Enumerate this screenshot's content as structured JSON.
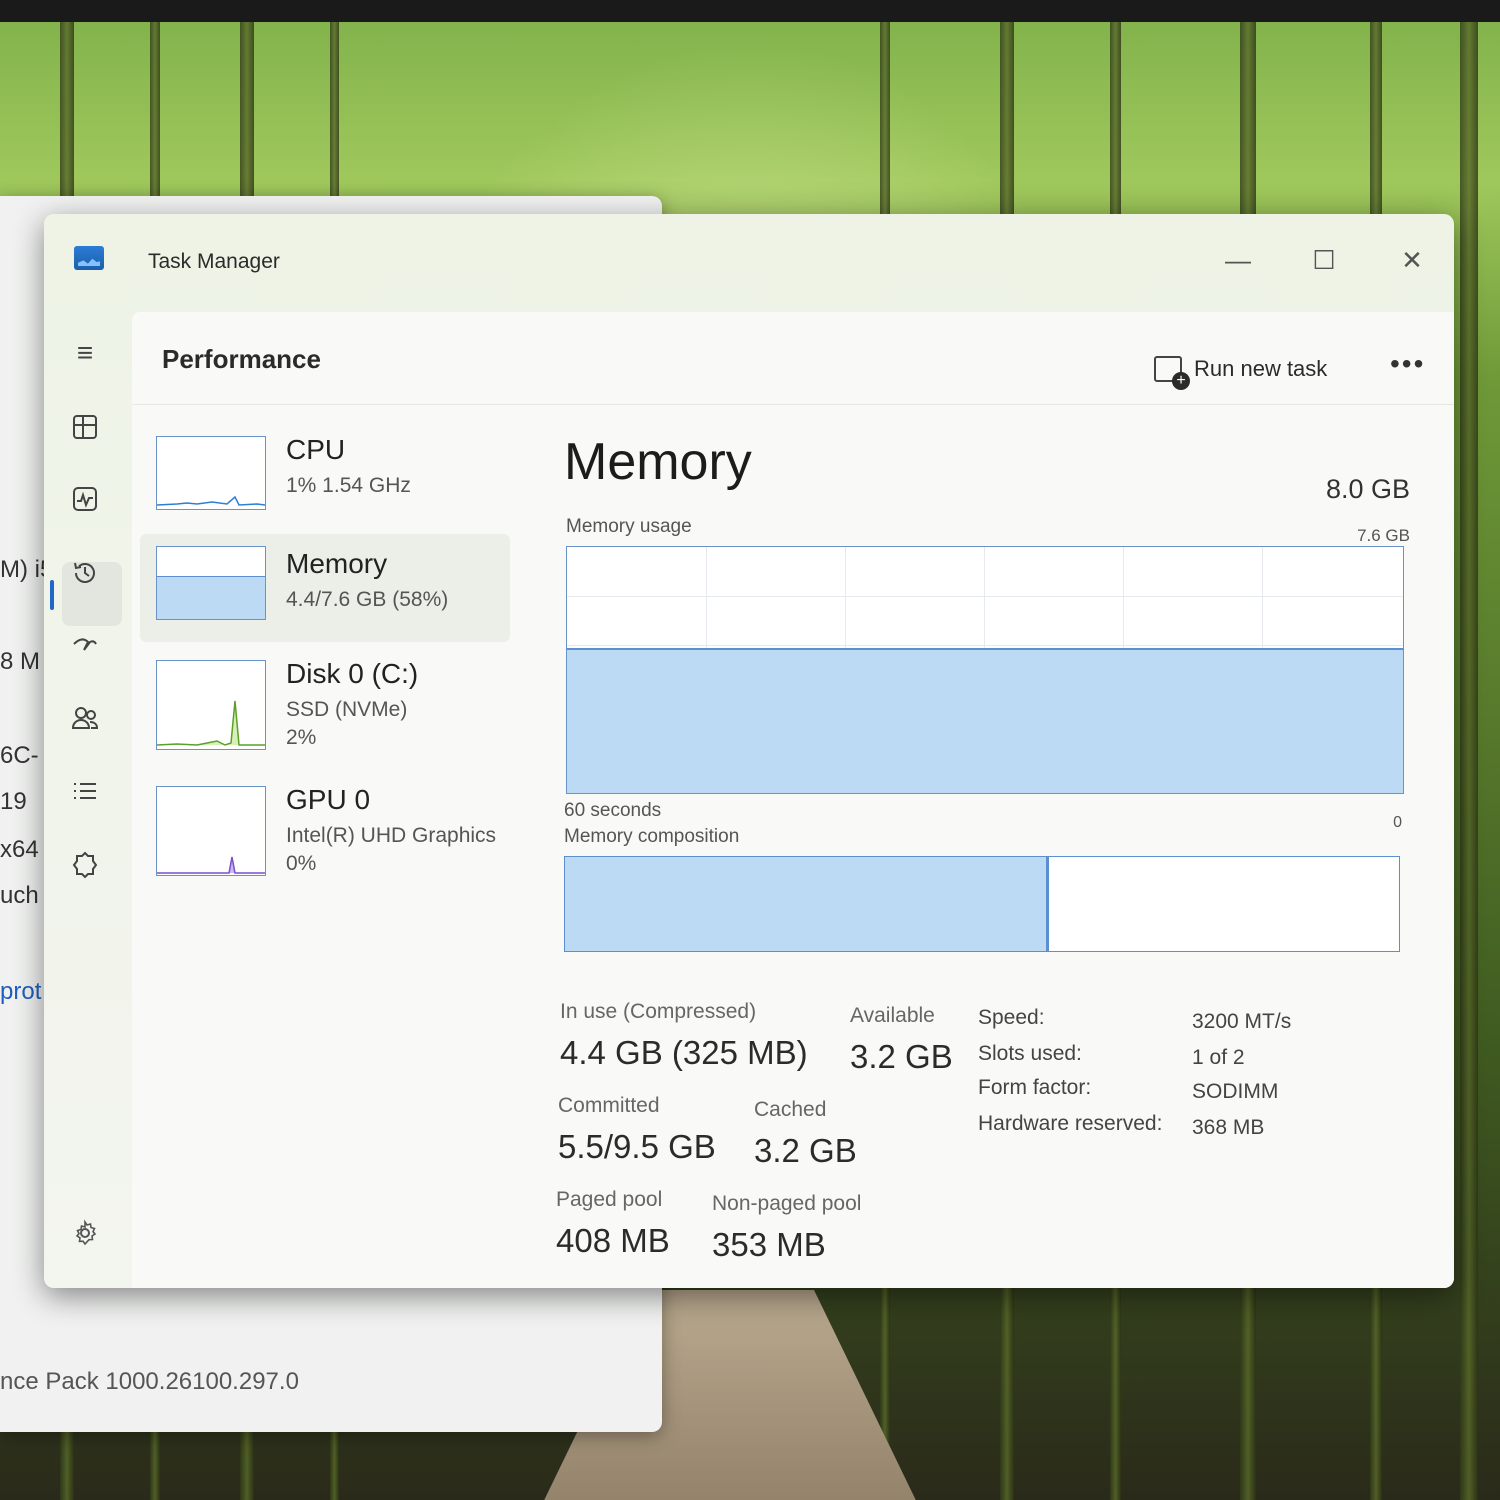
{
  "background_window": {
    "fragments": [
      "M) i5",
      "8 M",
      "6C-",
      "19",
      "x64",
      "uch",
      "prot"
    ],
    "footer": "nce Pack 1000.26100.297.0"
  },
  "window": {
    "title": "Task Manager",
    "minimize": "—",
    "maximize": "☐",
    "close": "✕"
  },
  "header": {
    "title": "Performance",
    "run_new_task": "Run new task",
    "more": "•••"
  },
  "rail": {
    "icons": [
      "hamburger-icon",
      "processes-icon",
      "performance-icon",
      "app-history-icon",
      "startup-apps-icon",
      "users-icon",
      "details-icon",
      "services-icon",
      "settings-icon"
    ]
  },
  "devices": [
    {
      "name": "CPU",
      "line1": "1%  1.54 GHz",
      "line2": ""
    },
    {
      "name": "Memory",
      "line1": "4.4/7.6 GB (58%)",
      "line2": ""
    },
    {
      "name": "Disk 0 (C:)",
      "line1": "SSD (NVMe)",
      "line2": "2%"
    },
    {
      "name": "GPU 0",
      "line1": "Intel(R) UHD Graphics",
      "line2": "0%"
    }
  ],
  "detail": {
    "title": "Memory",
    "total": "8.0 GB",
    "usage_label": "Memory usage",
    "usage_max": "7.6 GB",
    "time_label": "60 seconds",
    "zero_label": "0",
    "composition_label": "Memory composition",
    "usage_fraction": 0.58
  },
  "stats": {
    "in_use_label": "In use (Compressed)",
    "in_use_value": "4.4 GB (325 MB)",
    "available_label": "Available",
    "available_value": "3.2 GB",
    "committed_label": "Committed",
    "committed_value": "5.5/9.5 GB",
    "cached_label": "Cached",
    "cached_value": "3.2 GB",
    "paged_label": "Paged pool",
    "paged_value": "408 MB",
    "nonpaged_label": "Non-paged pool",
    "nonpaged_value": "353 MB"
  },
  "properties": [
    {
      "key": "Speed:",
      "value": "3200 MT/s"
    },
    {
      "key": "Slots used:",
      "value": "1 of 2"
    },
    {
      "key": "Form factor:",
      "value": "SODIMM"
    },
    {
      "key": "Hardware reserved:",
      "value": "368 MB"
    }
  ],
  "colors": {
    "accent": "#1f67c9",
    "memory_fill": "#bcdaf4",
    "memory_border": "#5b8fd0"
  }
}
